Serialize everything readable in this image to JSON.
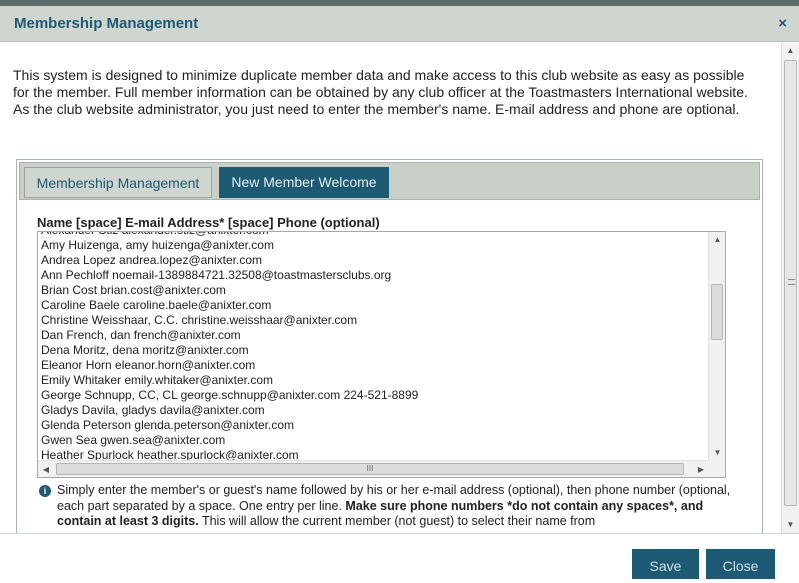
{
  "dialog": {
    "title": "Membership Management",
    "close_glyph": "×"
  },
  "intro": "This system is designed to minimize duplicate member data and make access to this club website as easy as possible for the member. Full member information can be obtained by any club officer at the Toastmasters International website. As the club website administrator, you just need to enter the member's name. E-mail address and phone are optional.",
  "tabs": [
    {
      "label": "Membership Management",
      "active": false
    },
    {
      "label": "New Member Welcome",
      "active": true
    }
  ],
  "member_field": {
    "label": "Name [space] E-mail Address* [space] Phone (optional)",
    "lines": [
      "Alexander Stiz alexander.stiz@anixter.com",
      "Amy Huizenga, amy huizenga@anixter.com",
      "Andrea Lopez andrea.lopez@anixter.com",
      "Ann Pechloff noemail-1389884721.32508@toastmastersclubs.org",
      "Brian Cost brian.cost@anixter.com",
      "Caroline Baele caroline.baele@anixter.com",
      "Christine Weisshaar, C.C. christine.weisshaar@anixter.com",
      "Dan French, dan french@anixter.com",
      "Dena Moritz, dena moritz@anixter.com",
      "Eleanor Horn eleanor.horn@anixter.com",
      "Emily Whitaker emily.whitaker@anixter.com",
      "George Schnupp, CC, CL george.schnupp@anixter.com 224-521-8899",
      "Gladys Davila, gladys davila@anixter.com",
      "Glenda Peterson glenda.peterson@anixter.com",
      "Gwen Sea gwen.sea@anixter.com",
      "Heather Spurlock heather.spurlock@anixter.com"
    ]
  },
  "help": {
    "part1": "Simply enter the member's or guest's name followed by his or her e-mail address (optional), then phone number (optional, each part separated by a space. One entry per line. ",
    "bold": "Make sure phone numbers *do not contain any spaces*, and contain at least 3 digits.",
    "part2": " This will allow the current member (not guest) to select their name from"
  },
  "scroll": {
    "up": "▲",
    "down": "▼",
    "left": "◀",
    "right": "▶",
    "grip": "III"
  },
  "buttons": {
    "save": "Save",
    "close": "Close"
  }
}
